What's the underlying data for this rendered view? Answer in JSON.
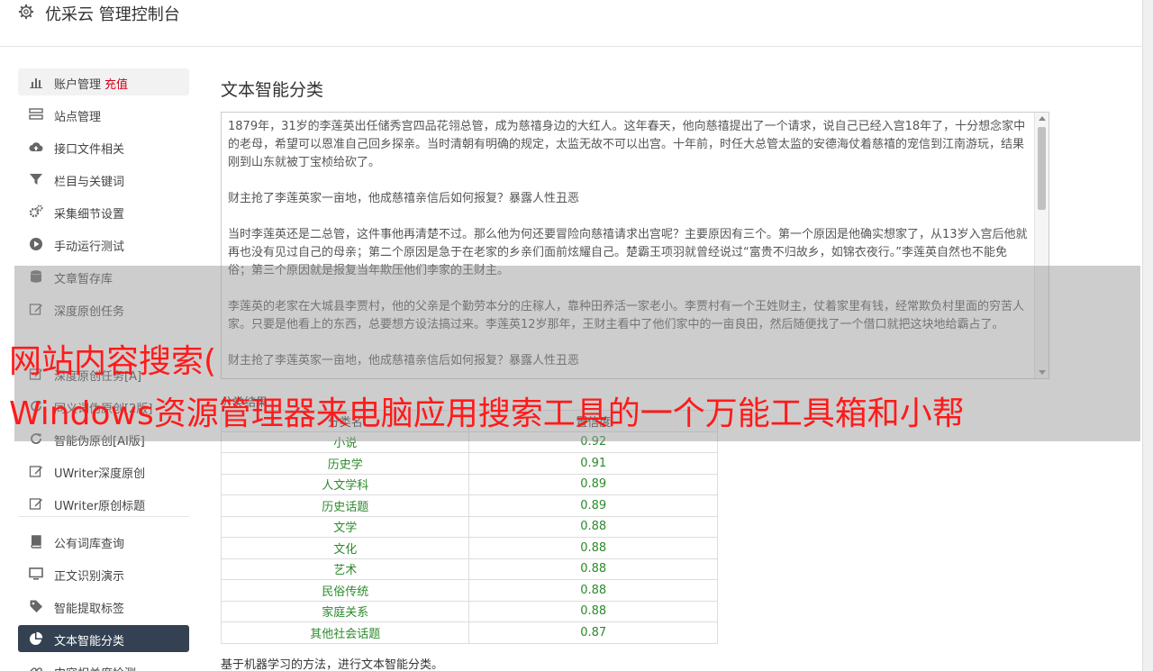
{
  "header": {
    "title": "优采云 管理控制台"
  },
  "sidebar": {
    "items": [
      {
        "label": "账户管理",
        "extra": "充值",
        "icon": "bar-chart-icon"
      },
      {
        "label": "站点管理",
        "icon": "server-icon"
      },
      {
        "label": "接口文件相关",
        "icon": "cloud-upload-icon"
      },
      {
        "label": "栏目与关键词",
        "icon": "filter-icon"
      },
      {
        "label": "采集细节设置",
        "icon": "gears-icon"
      },
      {
        "label": "手动运行测试",
        "icon": "play-circle-icon"
      },
      {
        "label": "文章暂存库",
        "icon": "database-icon"
      },
      {
        "label": "深度原创任务",
        "icon": "edit-icon"
      },
      {
        "label": "深度原创任务[A]",
        "icon": "edit-icon"
      },
      {
        "label": "同义词伪原创[2版]",
        "icon": "refresh-icon"
      },
      {
        "label": "智能伪原创[AI版]",
        "icon": "refresh-icon"
      },
      {
        "label": "UWriter深度原创",
        "icon": "edit-icon"
      },
      {
        "label": "UWriter原创标题",
        "icon": "edit-icon"
      },
      {
        "label": "公有词库查询",
        "icon": "book-icon"
      },
      {
        "label": "正文识别演示",
        "icon": "monitor-icon"
      },
      {
        "label": "智能提取标签",
        "icon": "tag-icon"
      },
      {
        "label": "文本智能分类",
        "icon": "pie-chart-icon"
      },
      {
        "label": "内容相关度检测",
        "icon": "link-icon"
      }
    ]
  },
  "main": {
    "title": "文本智能分类",
    "text_paragraphs": [
      "1879年，31岁的李莲英出任储秀宫四品花翎总管，成为慈禧身边的大红人。这年春天，他向慈禧提出了一个请求，说自己已经入宫18年了，十分想念家中的老母，希望可以恩准自己回乡探亲。当时清朝有明确的规定，太监无故不可以出宫。十年前，时任大总管太监的安德海仗着慈禧的宠信到江南游玩，结果刚到山东就被丁宝桢给砍了。",
      "财主抢了李莲英家一亩地，他成慈禧亲信后如何报复？暴露人性丑恶",
      "当时李莲英还是二总管，这件事他再清楚不过。那么他为何还要冒险向慈禧请求出宫呢？主要原因有三个。第一个原因是他确实想家了，从13岁入宫后他就再也没有见过自己的母亲；第二个原因是急于在老家的乡亲们面前炫耀自己。楚霸王项羽就曾经说过“富贵不归故乡，如锦衣夜行。”李莲英自然也不能免俗；第三个原因就是报复当年欺压他们李家的王财主。",
      "李莲英的老家在大城县李贾村，他的父亲是个勤劳本分的庄稼人，靠种田养活一家老小。李贾村有一个王姓财主，仗着家里有钱，经常欺负村里面的穷苦人家。只要是他看上的东西，总要想方设法搞过来。李莲英12岁那年，王财主看中了他们家中的一亩良田，然后随便找了一个借口就把这块地给霸占了。",
      "财主抢了李莲英家一亩地，他成慈禧亲信后如何报复？暴露人性丑恶"
    ],
    "result_label": "分类结果",
    "table": {
      "headers": [
        "分类名",
        "置信度"
      ],
      "rows": [
        [
          "小说",
          "0.92"
        ],
        [
          "历史学",
          "0.91"
        ],
        [
          "人文学科",
          "0.89"
        ],
        [
          "历史话题",
          "0.89"
        ],
        [
          "文学",
          "0.88"
        ],
        [
          "文化",
          "0.88"
        ],
        [
          "艺术",
          "0.88"
        ],
        [
          "民俗传统",
          "0.88"
        ],
        [
          "家庭关系",
          "0.88"
        ],
        [
          "其他社会话题",
          "0.87"
        ]
      ]
    },
    "footnote": "基于机器学习的方法，进行文本智能分类。"
  },
  "overlay": {
    "line1": "网站内容搜索(",
    "line2": "Windows资源管理器来电脑应用搜索工具的一个万能工具箱和小帮"
  },
  "colors": {
    "active_bg": "#334152",
    "accent_red": "#d0021b",
    "value_green": "#2c8a2c",
    "banner_red": "#ff1a1a"
  }
}
